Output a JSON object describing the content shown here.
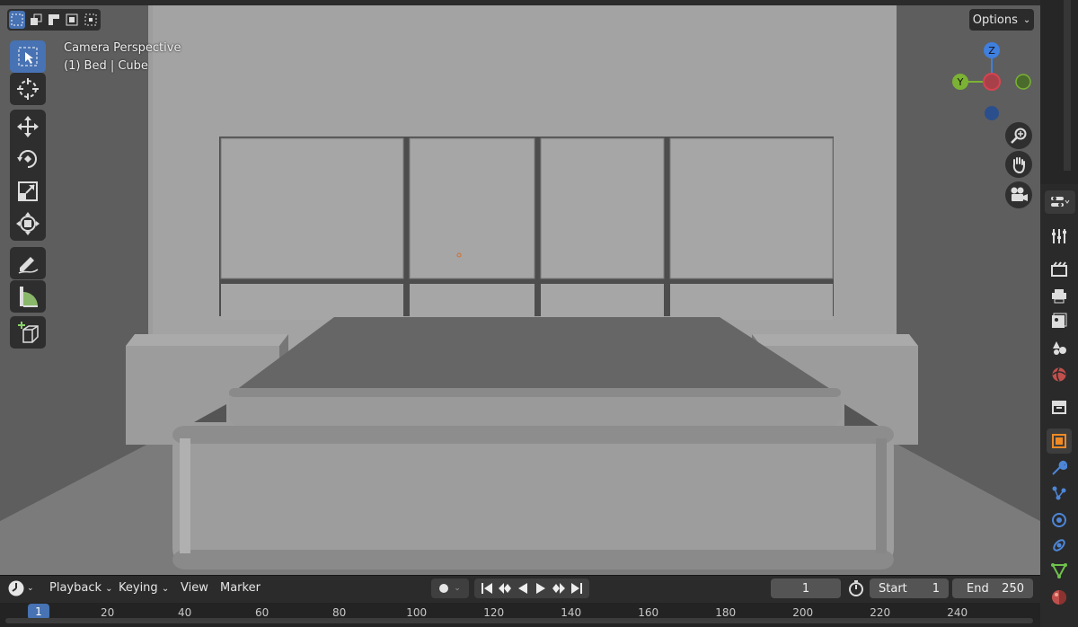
{
  "viewport": {
    "overlay_line1": "Camera Perspective",
    "overlay_line2": "(1) Bed | Cube",
    "options_label": "Options",
    "gizmo": {
      "z_label": "Z",
      "y_label": "Y",
      "x_color": "#d8434f",
      "y_color": "#7bb234",
      "z_color": "#3e7fe0"
    }
  },
  "toolbar": {
    "tools": [
      {
        "name": "select-box",
        "icon": "cursor-select-icon",
        "active": true
      },
      {
        "name": "cursor",
        "icon": "3d-cursor-icon",
        "active": false
      },
      {
        "name": "move",
        "icon": "move-icon",
        "active": false
      },
      {
        "name": "rotate",
        "icon": "rotate-icon",
        "active": false
      },
      {
        "name": "scale",
        "icon": "scale-icon",
        "active": false
      },
      {
        "name": "transform",
        "icon": "transform-icon",
        "active": false
      },
      {
        "name": "annotate",
        "icon": "annotate-pencil-icon",
        "active": false
      },
      {
        "name": "measure",
        "icon": "measure-icon",
        "active": false
      },
      {
        "name": "add-cube",
        "icon": "add-cube-icon",
        "active": false
      }
    ]
  },
  "properties": {
    "icons": [
      "tool-icon",
      "render-icon",
      "output-icon",
      "view-layer-icon",
      "scene-icon",
      "world-icon",
      "collection-icon",
      "object-icon",
      "modifier-icon",
      "particles-icon",
      "physics-icon",
      "constraints-icon",
      "data-icon",
      "material-icon"
    ]
  },
  "timeline": {
    "menus": {
      "playback": "Playback",
      "keying": "Keying",
      "view": "View",
      "marker": "Marker"
    },
    "current_frame": "1",
    "start_label": "Start",
    "start_value": "1",
    "end_label": "End",
    "end_value": "250",
    "ruler_ticks": [
      "1",
      "20",
      "40",
      "60",
      "80",
      "100",
      "120",
      "140",
      "160",
      "180",
      "200",
      "220",
      "240"
    ],
    "marker_frame": "1",
    "accent_color": "#4772b3"
  }
}
